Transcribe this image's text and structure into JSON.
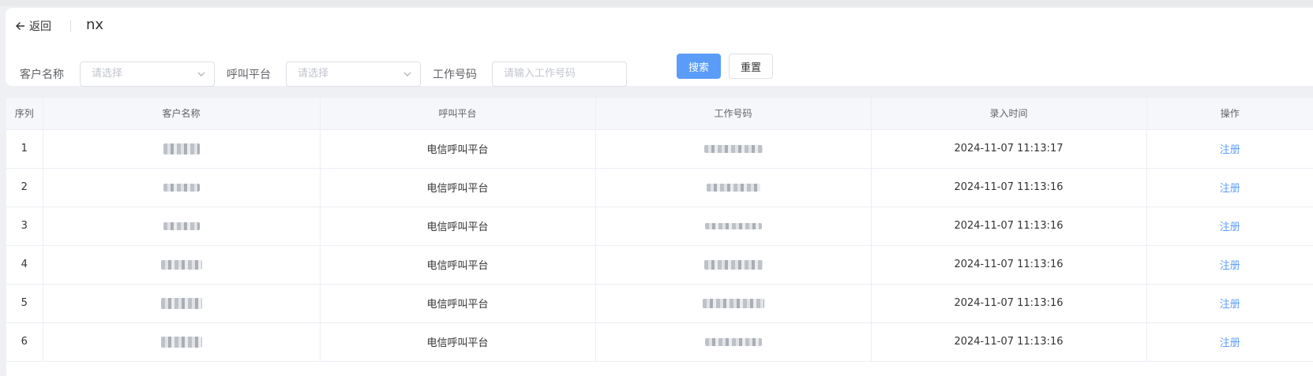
{
  "header": {
    "back_label": "返回",
    "title": "nx"
  },
  "filters": {
    "customer_label": "客户名称",
    "customer_placeholder": "请选择",
    "platform_label": "呼叫平台",
    "platform_placeholder": "请选择",
    "workno_label": "工作号码",
    "workno_placeholder": "请输入工作号码",
    "search_label": "搜索",
    "reset_label": "重置"
  },
  "table": {
    "columns": [
      "序列",
      "客户名称",
      "呼叫平台",
      "工作号码",
      "录入时间",
      "操作"
    ],
    "rows": [
      {
        "index": "1",
        "platform": "电信呼叫平台",
        "time": "2024-11-07 11:13:17",
        "action": "注册"
      },
      {
        "index": "2",
        "platform": "电信呼叫平台",
        "time": "2024-11-07 11:13:16",
        "action": "注册"
      },
      {
        "index": "3",
        "platform": "电信呼叫平台",
        "time": "2024-11-07 11:13:16",
        "action": "注册"
      },
      {
        "index": "4",
        "platform": "电信呼叫平台",
        "time": "2024-11-07 11:13:16",
        "action": "注册"
      },
      {
        "index": "5",
        "platform": "电信呼叫平台",
        "time": "2024-11-07 11:13:16",
        "action": "注册"
      },
      {
        "index": "6",
        "platform": "电信呼叫平台",
        "time": "2024-11-07 11:13:16",
        "action": "注册"
      }
    ]
  },
  "colors": {
    "primary": "#5a9cf8",
    "header_bg": "#f5f7fa",
    "page_bg": "#eef0f3"
  }
}
